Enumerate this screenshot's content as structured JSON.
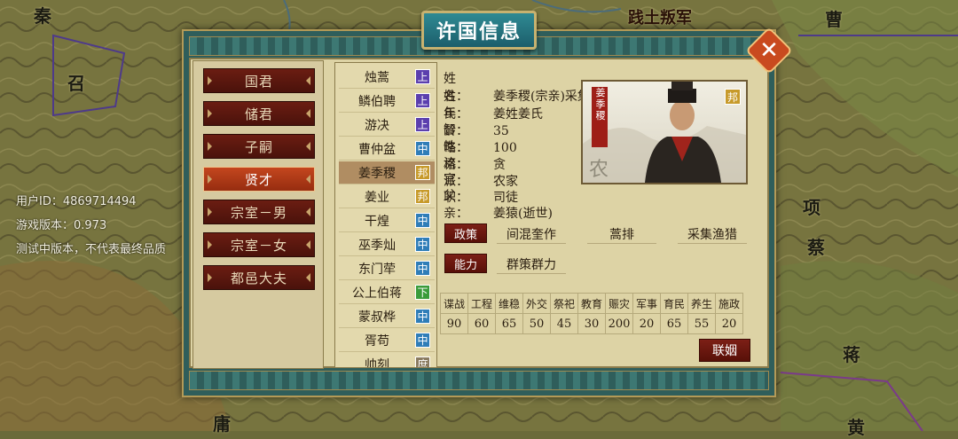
{
  "map": {
    "labels": [
      "秦",
      "召",
      "践土叛军",
      "曹",
      "项",
      "蔡",
      "蒋",
      "庸",
      "黄"
    ]
  },
  "overlay": {
    "user_id": "用户ID：4869714494",
    "version": "游戏版本：0.973",
    "notice": "测试中版本，不代表最终品质"
  },
  "panel": {
    "title": "许国信息",
    "close_icon": "close-icon"
  },
  "menu": {
    "items": [
      "国君",
      "储君",
      "子嗣",
      "贤才",
      "宗室－男",
      "宗室－女",
      "都邑大夫"
    ],
    "active_index": 3
  },
  "list": {
    "rows": [
      {
        "name": "烛蒿",
        "rank": "上",
        "color": "#5b3fae"
      },
      {
        "name": "鳞伯聘",
        "rank": "上",
        "color": "#5b3fae"
      },
      {
        "name": "游决",
        "rank": "上",
        "color": "#5b3fae"
      },
      {
        "name": "曹仲盆",
        "rank": "中",
        "color": "#2f7db8"
      },
      {
        "name": "姜季稷",
        "rank": "邦",
        "color": "#c79a2a"
      },
      {
        "name": "姜业",
        "rank": "邦",
        "color": "#c79a2a"
      },
      {
        "name": "干煌",
        "rank": "中",
        "color": "#2f7db8"
      },
      {
        "name": "巫季灿",
        "rank": "中",
        "color": "#2f7db8"
      },
      {
        "name": "东门荦",
        "rank": "中",
        "color": "#2f7db8"
      },
      {
        "name": "公上伯蒋",
        "rank": "下",
        "color": "#3a9b3a"
      },
      {
        "name": "蒙叔桦",
        "rank": "中",
        "color": "#2f7db8"
      },
      {
        "name": "胥苟",
        "rank": "中",
        "color": "#2f7db8"
      },
      {
        "name": "帅刻",
        "rank": "庶",
        "color": "#8a7b60"
      }
    ],
    "selected_index": 4
  },
  "info": {
    "name_label": "姓　　名：",
    "name_value": "姜季稷(宗亲)采集渔猎",
    "clan_label": "姓　　氏：",
    "clan_value": "姜姓姜氏",
    "age_label": "年　　龄：",
    "age_value": "35",
    "wisdom_label": "智　　略：",
    "wisdom_value": "100",
    "nature_label": "性　　格：",
    "nature_value": "贪",
    "school_label": "流　　派：",
    "school_value": "农家",
    "office_label": "官　　职：",
    "office_value": "司徒",
    "father_label": "父　　亲：",
    "father_value": "姜猿(逝世)"
  },
  "portrait": {
    "name_banner": "姜季稷",
    "badge": "邦",
    "school_char": "农"
  },
  "policy": {
    "policy_label": "政策",
    "policies": [
      "间混奎作",
      "蒿排",
      "采集渔猎"
    ],
    "ability_label": "能力",
    "abilities": [
      "群策群力"
    ]
  },
  "stats": {
    "headers": [
      "谍战",
      "工程",
      "维稳",
      "外交",
      "祭祀",
      "教育",
      "赈灾",
      "军事",
      "育民",
      "养生",
      "施政"
    ],
    "values": [
      "90",
      "60",
      "65",
      "50",
      "45",
      "30",
      "200",
      "20",
      "65",
      "55",
      "20"
    ]
  },
  "actions": {
    "marry": "联姻"
  }
}
